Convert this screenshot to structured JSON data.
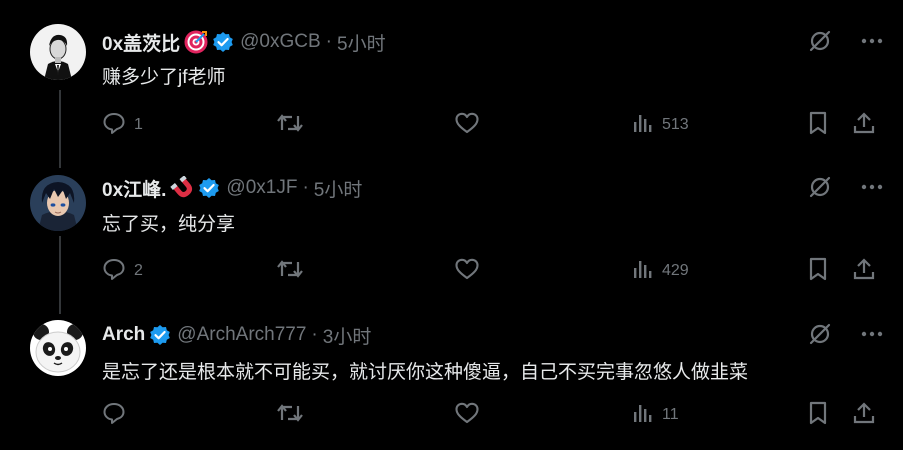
{
  "tweets": [
    {
      "name": "0x盖茨比",
      "badge": "target-emoji-icon",
      "handle": "@0xGCB",
      "separator": "·",
      "time": "5小时",
      "text": "赚多少了jf老师",
      "replies": "1",
      "retweets": "",
      "likes": "",
      "views": "513"
    },
    {
      "name": "0x江峰.",
      "badge": "magnet-emoji-icon",
      "handle": "@0x1JF",
      "separator": "·",
      "time": "5小时",
      "text": "忘了买，纯分享",
      "replies": "2",
      "retweets": "",
      "likes": "",
      "views": "429"
    },
    {
      "name": "Arch",
      "badge": "",
      "handle": "@ArchArch777",
      "separator": "·",
      "time": "3小时",
      "text": "是忘了还是根本就不可能买，就讨厌你这种傻逼，自己不买完事忽悠人做韭菜",
      "replies": "",
      "retweets": "",
      "likes": "",
      "views": "11"
    }
  ],
  "colors": {
    "background": "#000000",
    "text": "#e7e9ea",
    "muted": "#71767b",
    "verified": "#1d9bf0",
    "thread_line": "#333639"
  }
}
